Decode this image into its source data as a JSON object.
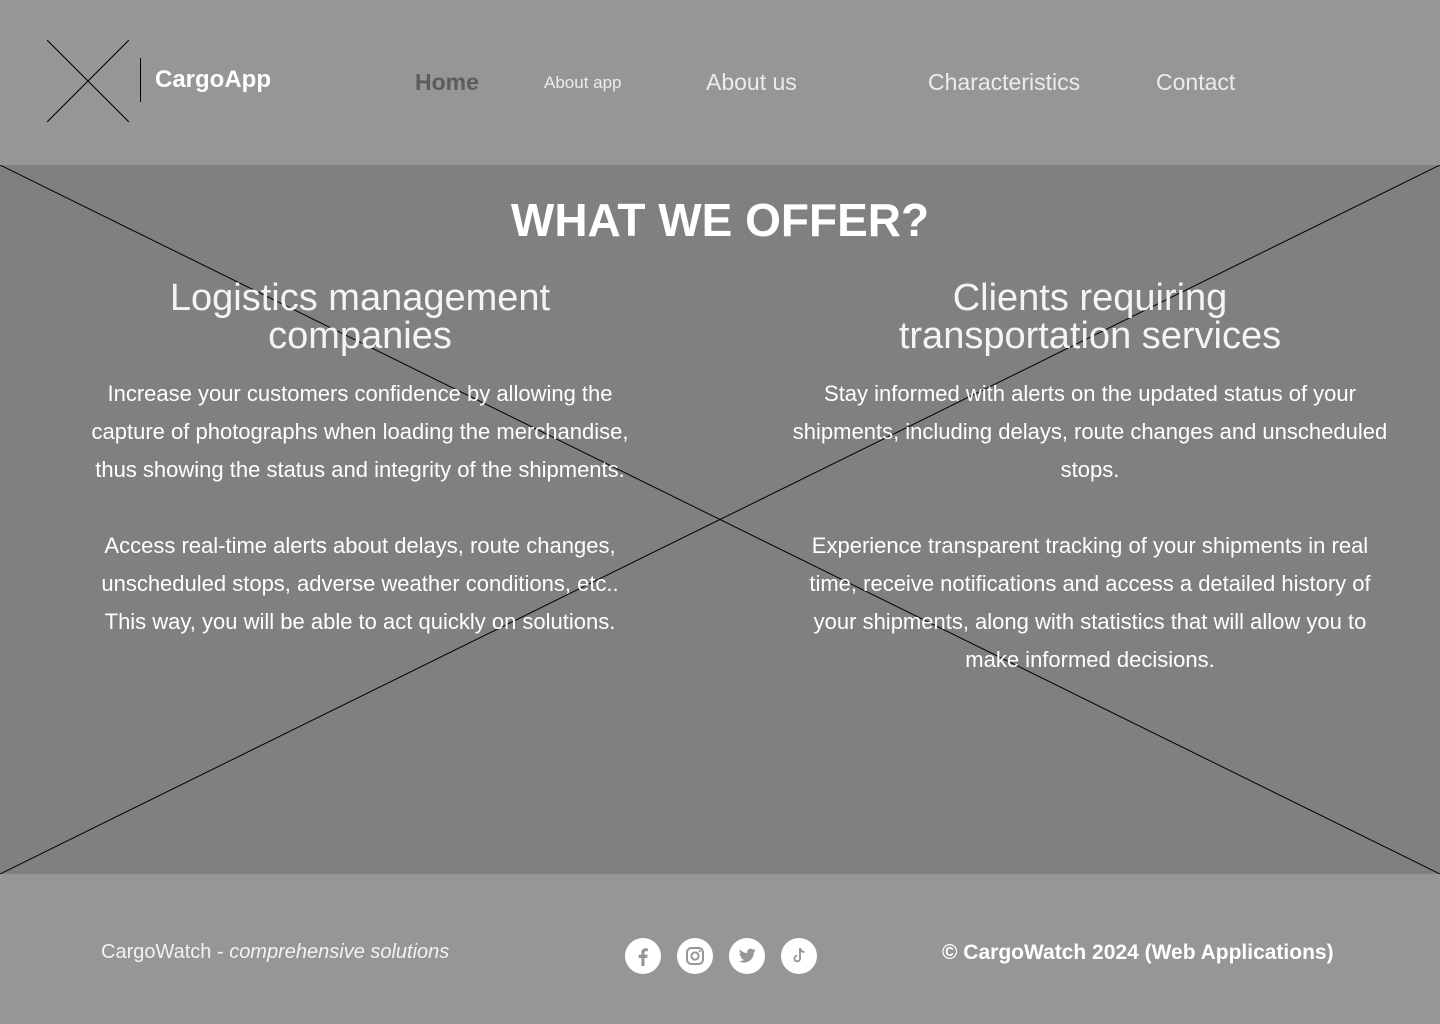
{
  "header": {
    "brand": "CargoApp",
    "logo_icon": "placeholder-x-icon",
    "nav": {
      "home": "Home",
      "about_app": "About app",
      "about_us": "About us",
      "characteristics": "Characteristics",
      "contact": "Contact"
    }
  },
  "main": {
    "title": "WHAT WE OFFER?",
    "background_icon": "placeholder-x-icon",
    "left": {
      "heading_line1": "Logistics management",
      "heading_line2": "companies",
      "paragraph1": "Increase your customers confidence by allowing the capture of photographs when loading the merchandise, thus showing the status and integrity of the shipments.",
      "paragraph2": "Access real-time alerts about delays, route changes, unscheduled stops, adverse weather conditions, etc.. This way, you will be able to act quickly on solutions."
    },
    "right": {
      "heading_line1": "Clients requiring",
      "heading_line2": "transportation services",
      "paragraph1": "Stay informed with alerts on the updated status of your shipments, including delays, route changes and unscheduled stops.",
      "paragraph2": "Experience transparent tracking of your shipments in real time, receive notifications and access a detailed history of your shipments, along with statistics that will allow you to make informed decisions."
    }
  },
  "footer": {
    "brand": "CargoWatch - ",
    "slogan": "comprehensive solutions",
    "copyright": "© CargoWatch 2024 (Web Applications)",
    "social_icons": [
      "facebook-icon",
      "instagram-icon",
      "twitter-icon",
      "tiktok-icon"
    ]
  },
  "colors": {
    "header_bg": "#969696",
    "main_bg": "#808080",
    "active_nav": "#5c5c5c",
    "text": "#ffffff"
  }
}
